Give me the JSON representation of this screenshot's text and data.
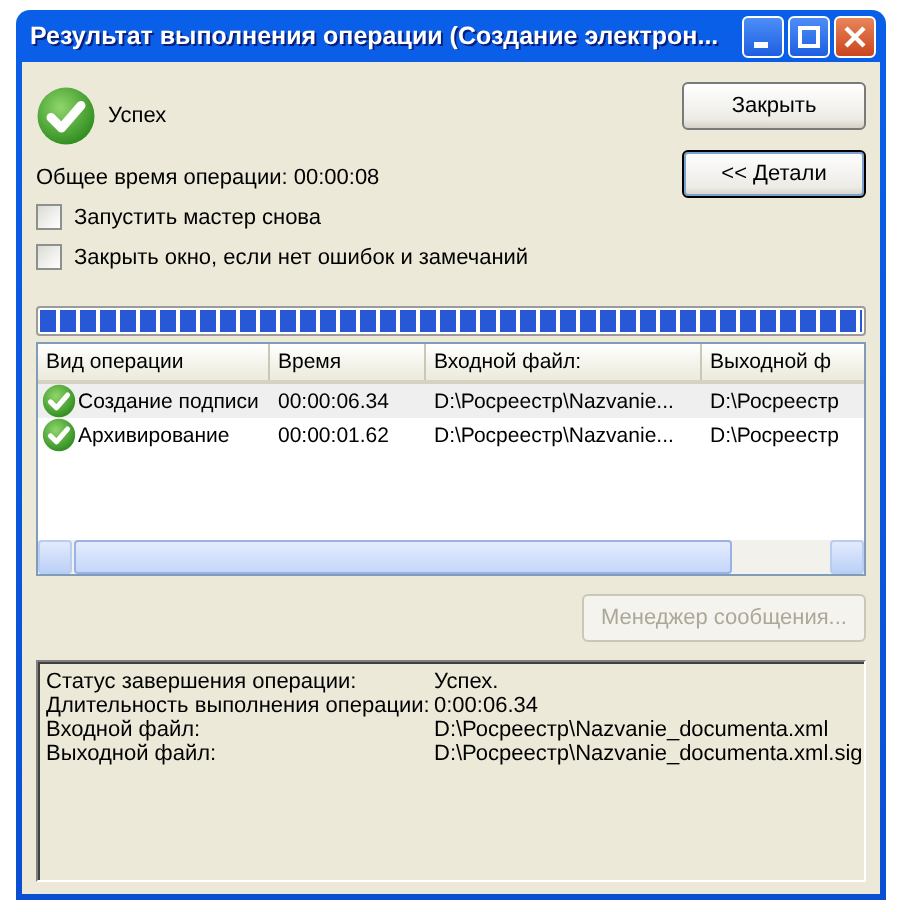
{
  "window": {
    "title": "Результат выполнения операции (Создание электрон..."
  },
  "status": {
    "text": "Успех"
  },
  "total_time": "Общее время операции: 00:00:08",
  "options": [
    {
      "label": "Запустить мастер снова",
      "checked": false
    },
    {
      "label": "Закрыть окно, если нет ошибок и замечаний",
      "checked": false
    }
  ],
  "buttons": [
    {
      "label": "Закрыть",
      "focused": false
    },
    {
      "label": "<< Детали",
      "focused": true
    }
  ],
  "progress": {
    "level": 1
  },
  "table": {
    "columns": [
      "Вид операции",
      "Время",
      "Входной файл:",
      "Выходной ф"
    ],
    "rows": [
      {
        "cells": [
          "Создание подписи",
          "00:00:06.34",
          "D:\\Росреестр\\Nazvanie...",
          "D:\\Росреестр"
        ],
        "selected": true
      },
      {
        "cells": [
          "Архивирование",
          "00:00:01.62",
          "D:\\Росреестр\\Nazvanie...",
          "D:\\Росреестр"
        ],
        "selected": false
      }
    ]
  },
  "manager_button": {
    "label": "Менеджер сообщения...",
    "disabled": true
  },
  "details": [
    {
      "label": "Статус завершения операции:",
      "value": "Успех."
    },
    {
      "label": "Длительность выполнения операции:",
      "value": "0:00:06.34"
    },
    {
      "label": "Входной файл:",
      "value": "D:\\Росреестр\\Nazvanie_documenta.xml"
    },
    {
      "label": "Выходной файл:",
      "value": "D:\\Росреестр\\Nazvanie_documenta.xml.sig"
    }
  ]
}
